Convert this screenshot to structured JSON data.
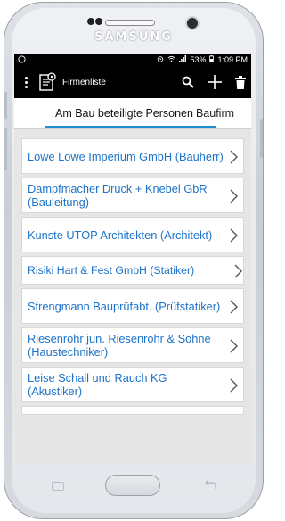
{
  "device": {
    "brand": "SAMSUNG"
  },
  "status": {
    "left_icon": "whatsapp-icon",
    "battery": "53%",
    "time": "1:09 PM"
  },
  "appbar": {
    "title": "Firmenliste",
    "menu_icon": "overflow-menu-icon",
    "search_icon": "search-icon",
    "add_icon": "plus-icon",
    "delete_icon": "trash-icon"
  },
  "tabs": {
    "active": "Am Bau beteiligte Personen",
    "next": "Baufirm",
    "indicator_color": "#1f8fd1"
  },
  "list": {
    "text_color": "#1d73c9",
    "items": [
      {
        "label": "Löwe Löwe Imperium GmbH (Bauherr)"
      },
      {
        "label": "Dampfmacher Druck + Knebel GbR (Bauleitung)"
      },
      {
        "label": "Kunste UTOP Architekten (Architekt)"
      },
      {
        "label": "Risiki Hart & Fest GmbH (Statiker)"
      },
      {
        "label": "Strengmann Bauprüfabt. (Prüfstatiker)"
      },
      {
        "label": "Riesenrohr jun. Riesenrohr & Söhne (Haustechniker)"
      },
      {
        "label": "Leise Schall und Rauch KG (Akustiker)"
      }
    ]
  }
}
